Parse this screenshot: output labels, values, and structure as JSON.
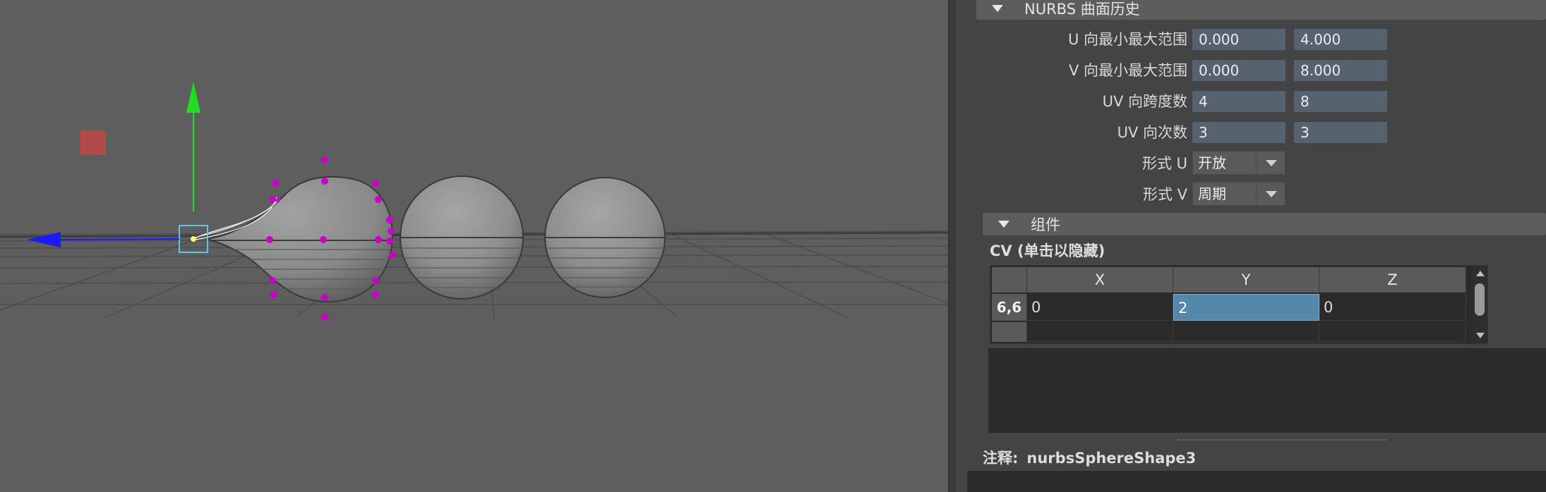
{
  "nurbs_section": {
    "title": "NURBS 曲面历史",
    "rows": [
      {
        "label": "U 向最小最大范围",
        "v1": "0.000",
        "v2": "4.000"
      },
      {
        "label": "V 向最小最大范围",
        "v1": "0.000",
        "v2": "8.000"
      },
      {
        "label": "UV 向跨度数",
        "v1": "4",
        "v2": "8"
      },
      {
        "label": "UV 向次数",
        "v1": "3",
        "v2": "3"
      }
    ],
    "form_u": {
      "label": "形式 U",
      "value": "开放"
    },
    "form_v": {
      "label": "形式 V",
      "value": "周期"
    }
  },
  "components_section": {
    "title": "组件",
    "cv_title": "CV (单击以隐藏)",
    "table": {
      "columns": [
        "X",
        "Y",
        "Z"
      ],
      "row_header": "6,6",
      "cells": [
        "0",
        "2",
        "0"
      ]
    }
  },
  "notes": {
    "label": "注释:",
    "value": "nurbsSphereShape3"
  },
  "colors": {
    "viewport_bg": "#5e5e5e",
    "cv_point": "#c800c8",
    "axis_y": "#22dd22",
    "axis_x": "#1a1aff",
    "selected_cell": "#5587ab"
  }
}
